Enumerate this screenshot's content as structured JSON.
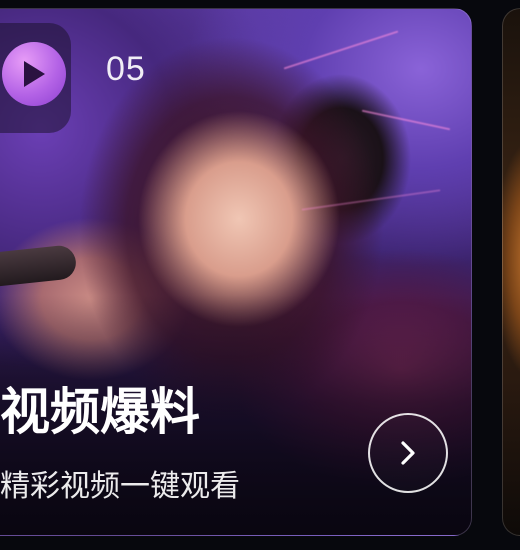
{
  "card": {
    "episode_number": "05",
    "title": "视频爆料",
    "subtitle": "精彩视频一键观看",
    "play_icon": "play-icon",
    "next_icon": "chevron-right-icon"
  },
  "colors": {
    "play_accent": "#b463e6",
    "background": "#07080d",
    "text": "#ffffff"
  }
}
